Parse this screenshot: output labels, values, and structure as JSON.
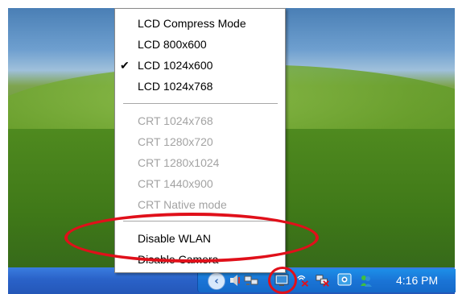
{
  "menu": {
    "items": [
      {
        "label": "LCD Compress Mode",
        "enabled": true,
        "checked": false
      },
      {
        "label": "LCD 800x600",
        "enabled": true,
        "checked": false
      },
      {
        "label": "LCD 1024x600",
        "enabled": true,
        "checked": true
      },
      {
        "label": "LCD 1024x768",
        "enabled": true,
        "checked": false
      },
      {
        "label": "CRT 1024x768",
        "enabled": false,
        "checked": false
      },
      {
        "label": "CRT 1280x720",
        "enabled": false,
        "checked": false
      },
      {
        "label": "CRT 1280x1024",
        "enabled": false,
        "checked": false
      },
      {
        "label": "CRT 1440x900",
        "enabled": false,
        "checked": false
      },
      {
        "label": "CRT Native mode",
        "enabled": false,
        "checked": false
      },
      {
        "label": "Disable WLAN",
        "enabled": true,
        "checked": false
      },
      {
        "label": "Disable Camera",
        "enabled": true,
        "checked": false
      }
    ],
    "check_glyph": "✔"
  },
  "taskbar": {
    "clock": "4:16 PM",
    "tray_expand_glyph": "‹",
    "tray_icons": [
      "volume-icon",
      "network-icon",
      "display-settings-icon",
      "wireless-disconnected-icon",
      "network-disconnected-icon",
      "security-center-icon",
      "messenger-icon"
    ]
  },
  "colors": {
    "annotation": "#e0101a",
    "taskbar": "#2a62c8",
    "tray": "#1a74d6"
  }
}
